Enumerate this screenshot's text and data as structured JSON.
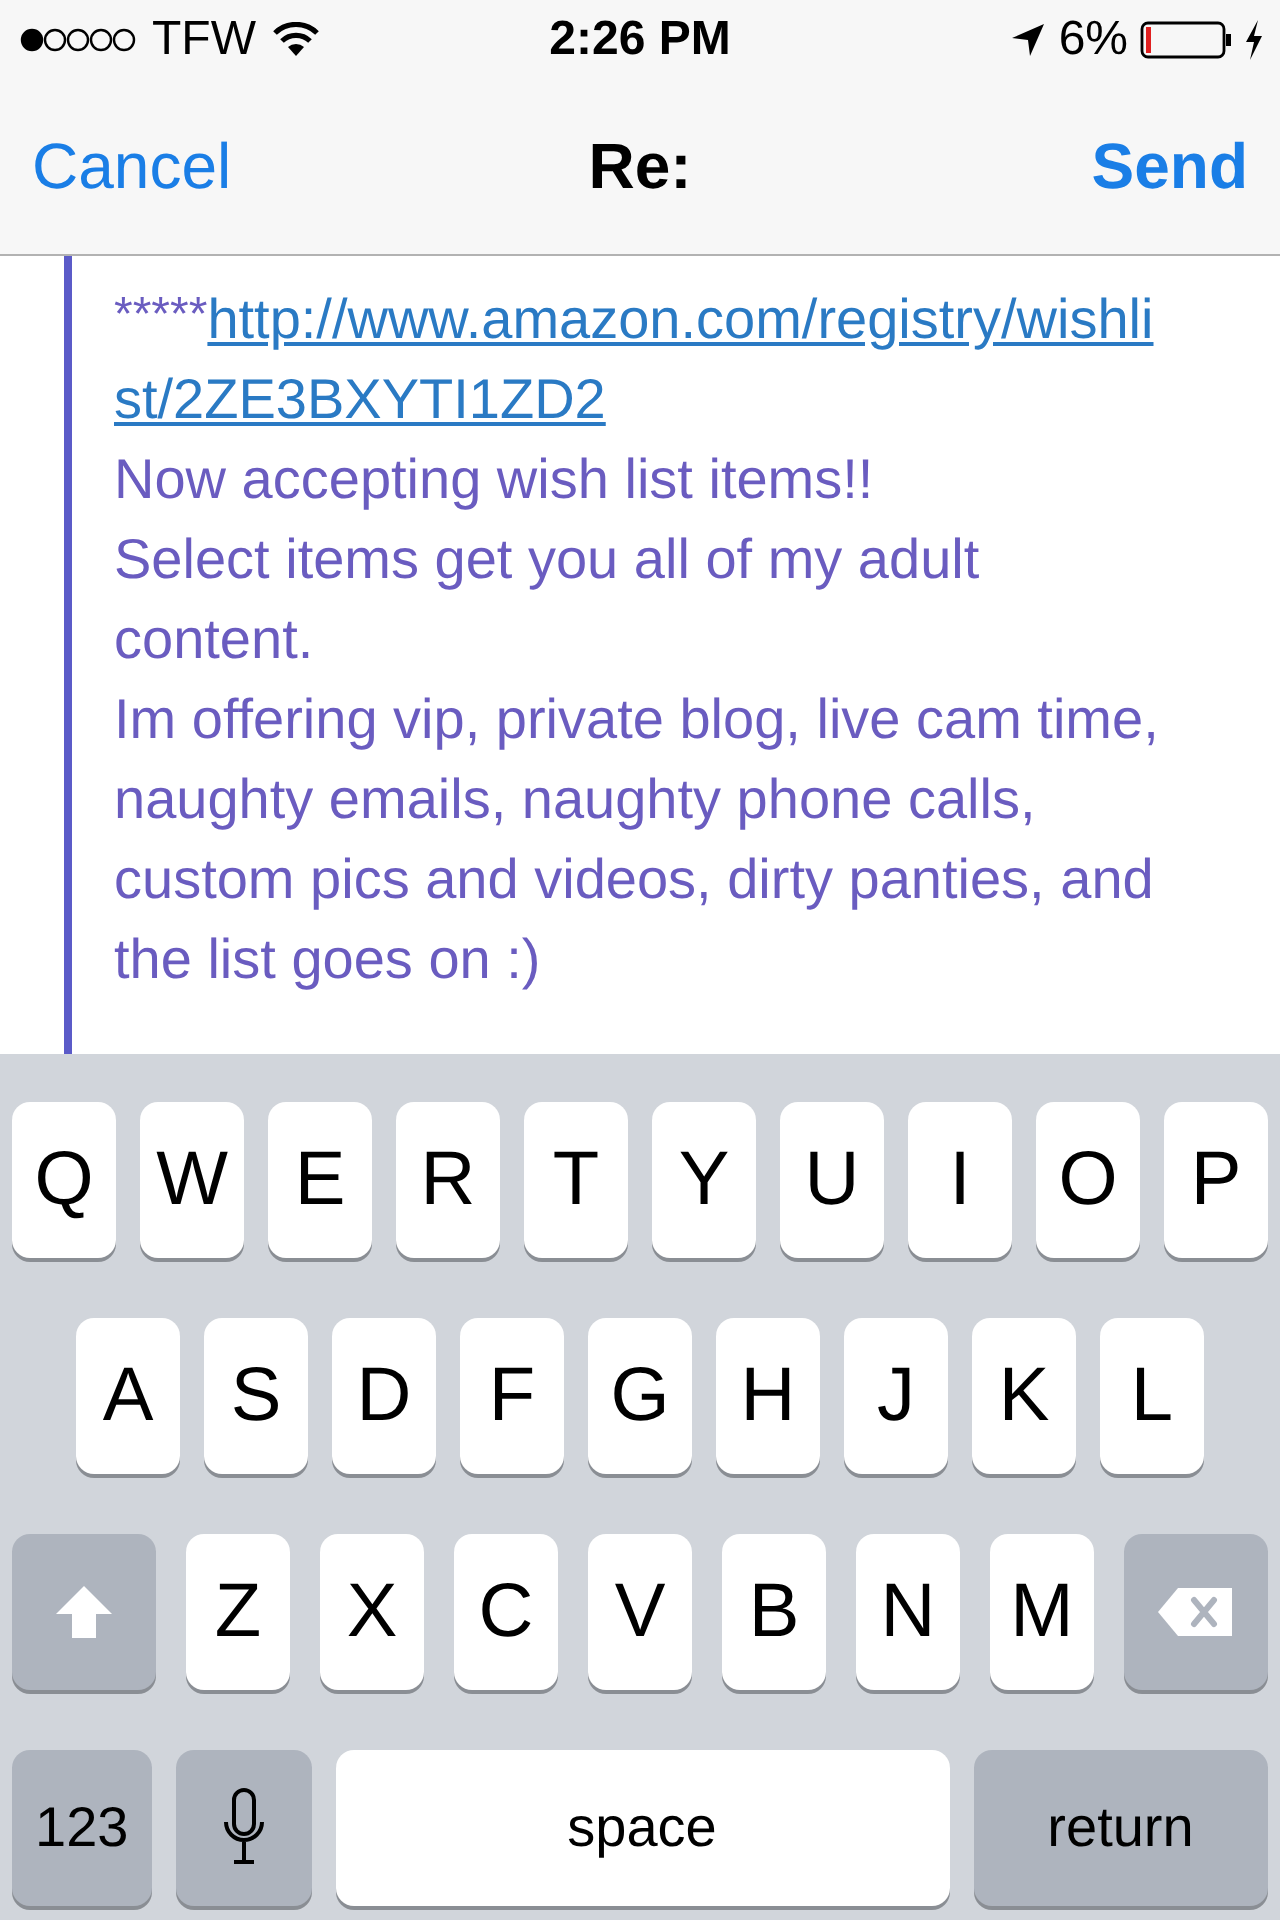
{
  "status_bar": {
    "carrier": "TFW",
    "time": "2:26 PM",
    "battery": "6%"
  },
  "nav_bar": {
    "cancel": "Cancel",
    "title": "Re:",
    "send": "Send"
  },
  "quoted_message": {
    "prefix": "*****",
    "link": "http://www.amazon.com/registry/wishlist/2ZE3BXYTI1ZD2",
    "paragraphs": [
      "Now accepting wish list items!!",
      "Select items get you all of my adult content.",
      "Im offering vip, private blog, live cam time, naughty emails, naughty phone calls, custom pics and videos, dirty panties, and the list goes on :)"
    ]
  },
  "keyboard": {
    "key_rows": [
      [
        {
          "kind": "letter",
          "label": "Q"
        },
        {
          "kind": "letter",
          "label": "W"
        },
        {
          "kind": "letter",
          "label": "E"
        },
        {
          "kind": "letter",
          "label": "R"
        },
        {
          "kind": "letter",
          "label": "T"
        },
        {
          "kind": "letter",
          "label": "Y"
        },
        {
          "kind": "letter",
          "label": "U"
        },
        {
          "kind": "letter",
          "label": "I"
        },
        {
          "kind": "letter",
          "label": "O"
        },
        {
          "kind": "letter",
          "label": "P"
        }
      ],
      [
        {
          "kind": "letter",
          "label": "A"
        },
        {
          "kind": "letter",
          "label": "S"
        },
        {
          "kind": "letter",
          "label": "D"
        },
        {
          "kind": "letter",
          "label": "F"
        },
        {
          "kind": "letter",
          "label": "G"
        },
        {
          "kind": "letter",
          "label": "H"
        },
        {
          "kind": "letter",
          "label": "J"
        },
        {
          "kind": "letter",
          "label": "K"
        },
        {
          "kind": "letter",
          "label": "L"
        }
      ],
      [
        {
          "kind": "shift"
        },
        {
          "kind": "letter",
          "label": "Z"
        },
        {
          "kind": "letter",
          "label": "X"
        },
        {
          "kind": "letter",
          "label": "C"
        },
        {
          "kind": "letter",
          "label": "V"
        },
        {
          "kind": "letter",
          "label": "B"
        },
        {
          "kind": "letter",
          "label": "N"
        },
        {
          "kind": "letter",
          "label": "M"
        },
        {
          "kind": "delete"
        }
      ],
      [
        {
          "kind": "mode",
          "label": "123"
        },
        {
          "kind": "mic"
        },
        {
          "kind": "space",
          "label": "space"
        },
        {
          "kind": "return",
          "label": "return"
        }
      ]
    ]
  }
}
